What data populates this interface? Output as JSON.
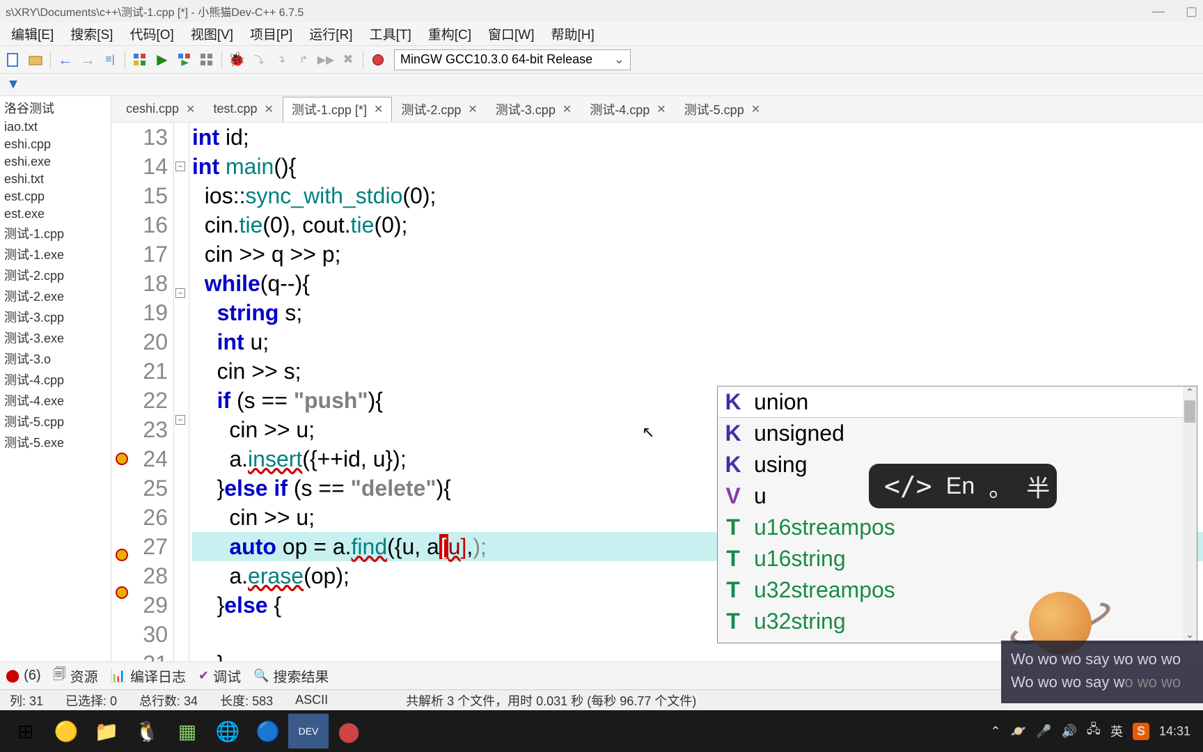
{
  "title": "s\\XRY\\Documents\\c++\\测试-1.cpp [*] - 小熊猫Dev-C++ 6.7.5",
  "menu": [
    "编辑[E]",
    "搜索[S]",
    "代码[O]",
    "视图[V]",
    "项目[P]",
    "运行[R]",
    "工具[T]",
    "重构[C]",
    "窗口[W]",
    "帮助[H]"
  ],
  "compiler": "MinGW GCC10.3.0 64-bit Release",
  "sidebar_files": [
    "洛谷测试",
    "iao.txt",
    "eshi.cpp",
    "eshi.exe",
    "eshi.txt",
    "est.cpp",
    "est.exe",
    "测试-1.cpp",
    "测试-1.exe",
    "测试-2.cpp",
    "测试-2.exe",
    "测试-3.cpp",
    "测试-3.exe",
    "测试-3.o",
    "测试-4.cpp",
    "测试-4.exe",
    "测试-5.cpp",
    "测试-5.exe"
  ],
  "tabs": [
    {
      "label": "ceshi.cpp",
      "active": false
    },
    {
      "label": "test.cpp",
      "active": false
    },
    {
      "label": "测试-1.cpp [*]",
      "active": true
    },
    {
      "label": "测试-2.cpp",
      "active": false
    },
    {
      "label": "测试-3.cpp",
      "active": false
    },
    {
      "label": "测试-4.cpp",
      "active": false
    },
    {
      "label": "测试-5.cpp",
      "active": false
    }
  ],
  "code_start_line": 13,
  "breakpoint_lines": [
    24,
    27,
    28
  ],
  "highlighted_line": 27,
  "autocomplete": [
    {
      "kind": "K",
      "label": "union",
      "sel": true
    },
    {
      "kind": "K",
      "label": "unsigned"
    },
    {
      "kind": "K",
      "label": "using"
    },
    {
      "kind": "V",
      "label": "u"
    },
    {
      "kind": "T",
      "label": "u16streampos"
    },
    {
      "kind": "T",
      "label": "u16string"
    },
    {
      "kind": "T",
      "label": "u32streampos"
    },
    {
      "kind": "T",
      "label": "u32string"
    }
  ],
  "bottom_tabs": [
    {
      "icon": "⬤",
      "label": "(6)"
    },
    {
      "icon": "🗐",
      "label": "资源"
    },
    {
      "icon": "📊",
      "label": "编译日志"
    },
    {
      "icon": "✔",
      "label": "调试"
    },
    {
      "icon": "🔍",
      "label": "搜索结果"
    }
  ],
  "status": {
    "col": "列:   31",
    "sel": "已选择:     0",
    "lines": "总行数:    34",
    "len": "长度:   583",
    "enc": "ASCII",
    "parse": "共解析 3 个文件，用时 0.031 秒 (每秒 96.77 个文件)"
  },
  "ime": {
    "code": "</>",
    "lang": "En",
    "dot": "。",
    "half": "半"
  },
  "lyrics": {
    "l1": "Wo wo wo say wo wo wo",
    "l2a": "Wo wo wo say w",
    "l2b": "o  wo wo"
  },
  "tray": {
    "ime_lang": "英",
    "time": "14:31"
  }
}
